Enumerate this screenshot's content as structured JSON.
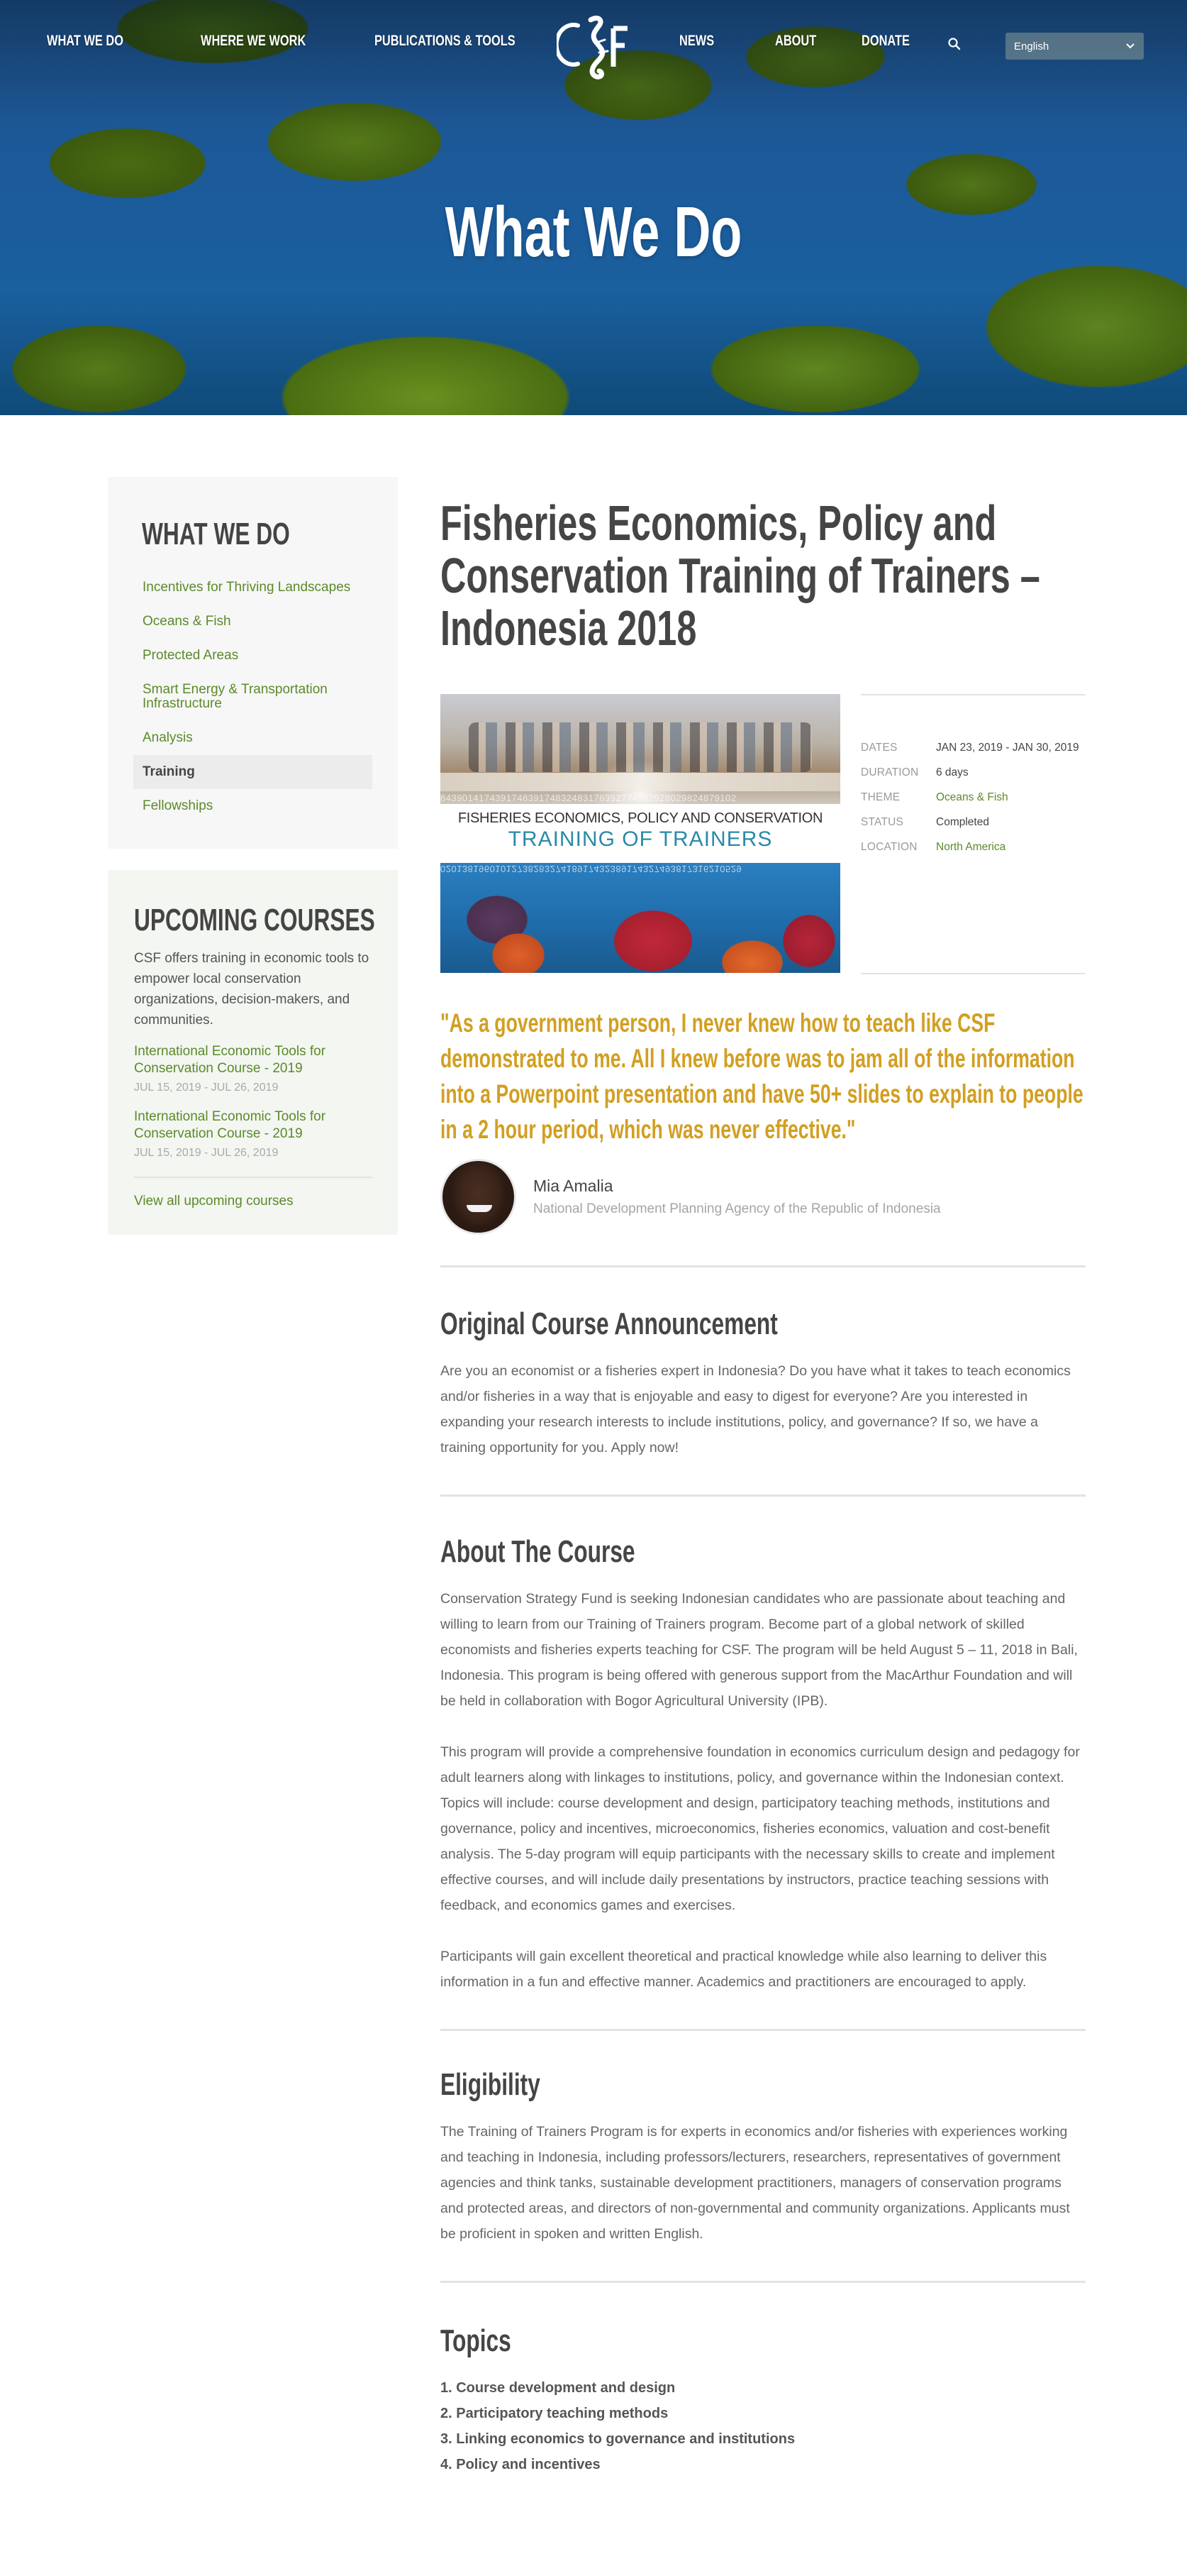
{
  "nav": {
    "items": [
      "WHAT WE DO",
      "WHERE WE WORK",
      "PUBLICATIONS & TOOLS",
      "NEWS",
      "ABOUT",
      "DONATE"
    ],
    "logo_text": "CSF",
    "search_icon": "search-icon",
    "language": {
      "selected": "English",
      "icon": "chevron-down-icon"
    }
  },
  "hero": {
    "title": "What We Do"
  },
  "sidebar": {
    "what_we_do": {
      "title": "WHAT WE DO",
      "items": [
        {
          "label": "Incentives for Thriving Landscapes",
          "active": false
        },
        {
          "label": "Oceans & Fish",
          "active": false
        },
        {
          "label": "Protected Areas",
          "active": false
        },
        {
          "label": "Smart Energy & Transportation Infrastructure",
          "active": false
        },
        {
          "label": "Analysis",
          "active": false
        },
        {
          "label": "Training",
          "active": true
        },
        {
          "label": "Fellowships",
          "active": false
        }
      ]
    },
    "upcoming": {
      "title": "UPCOMING COURSES",
      "description": "CSF offers training in economic tools to empower local conservation organizations, decision-makers, and communities.",
      "courses": [
        {
          "title": "International Economic Tools for Conservation Course - 2019",
          "dates": "JUL 15, 2019 - JUL 26, 2019"
        },
        {
          "title": "International Economic Tools for Conservation Course - 2019",
          "dates": "JUL 15, 2019 - JUL 26, 2019"
        }
      ],
      "view_all": "View all upcoming courses"
    }
  },
  "main": {
    "title": "Fisheries Economics, Policy and Conservation Training of Trainers – Indonesia 2018",
    "image": {
      "line1": "FISHERIES ECONOMICS, POLICY AND CONSERVATION",
      "line2": "TRAINING OF TRAINERS",
      "digits_top": "843901417439174839174832483176392774392928029824879102",
      "digits_bottom": "0201381960101273828327418917432389174327493817316210529"
    },
    "meta": [
      {
        "key": "DATES",
        "value": "JAN 23, 2019 - JAN 30, 2019",
        "link": false
      },
      {
        "key": "DURATION",
        "value": "6 days",
        "link": false
      },
      {
        "key": "THEME",
        "value": "Oceans & Fish",
        "link": true
      },
      {
        "key": "STATUS",
        "value": "Completed",
        "link": false
      },
      {
        "key": "LOCATION",
        "value": "North America",
        "link": true
      }
    ],
    "quote": "\"As a government person, I never knew how to teach like CSF demonstrated to me. All I knew before was to jam all of the information into a Powerpoint presentation and have 50+ slides to explain to people in a 2 hour period, which was never effective.\"",
    "author": {
      "name": "Mia Amalia",
      "organization": "National Development Planning Agency of the Republic of Indonesia"
    },
    "sections": {
      "announcement": {
        "title": "Original Course Announcement",
        "paragraphs": [
          "Are you an economist or a fisheries expert in Indonesia? Do you have what it takes to teach economics and/or fisheries in a way that is enjoyable and easy to digest for everyone? Are you interested in expanding your research interests to include institutions, policy, and governance? If so, we have a training opportunity for you. Apply now!"
        ]
      },
      "about": {
        "title": "About The Course",
        "paragraphs": [
          "Conservation Strategy Fund is seeking Indonesian candidates who are passionate about teaching and willing to learn from our Training of Trainers program. Become part of a global network of skilled economists and fisheries experts teaching for CSF. The program will be held August 5 – 11, 2018 in Bali, Indonesia. This program is being offered with generous support from the MacArthur Foundation and will be held in collaboration with Bogor Agricultural University (IPB).",
          "This program will provide a comprehensive foundation in economics curriculum design and pedagogy for adult learners along with linkages to institutions, policy, and governance within the Indonesian context. Topics will include: course development and design, participatory teaching methods, institutions and governance, policy and incentives, microeconomics, fisheries economics, valuation and cost-benefit analysis. The 5-day program will equip participants with the necessary skills to create and implement effective courses, and will include daily presentations by instructors, practice teaching sessions with feedback, and economics games and exercises.",
          "Participants will gain excellent theoretical and practical knowledge while also learning to deliver this information in a fun and effective manner. Academics and practitioners are encouraged to apply."
        ]
      },
      "eligibility": {
        "title": "Eligibility",
        "paragraphs": [
          "The Training of Trainers Program is for experts in economics and/or fisheries with experiences working and teaching in Indonesia, including professors/lecturers, researchers, representatives of government agencies and think tanks, sustainable development practitioners, managers of conservation programs and protected areas, and directors of non-governmental and community organizations. Applicants must be proficient in spoken and written English."
        ]
      },
      "topics": {
        "title": "Topics",
        "items": [
          "1. Course development and design",
          "2. Participatory teaching methods",
          "3. Linking economics to governance and institutions",
          "4. Policy and incentives"
        ]
      }
    }
  },
  "colors": {
    "accent_green": "#5b8a2a",
    "quote_gold": "#d29f22",
    "heading_gray": "#454545",
    "image_teal": "#2a8aa8"
  }
}
